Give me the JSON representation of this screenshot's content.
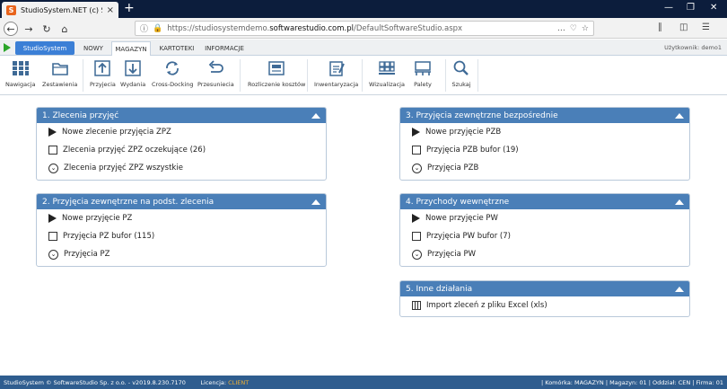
{
  "browser": {
    "tab_title": "StudioSystem.NET (c) Software",
    "favicon": "S",
    "url_prefix": "https://studiosystemdemo.",
    "url_domain": "softwarestudio.com.pl",
    "url_path": "/DefaultSoftwareStudio.aspx"
  },
  "appmenu": {
    "brand": "StudioSystem",
    "tabs": [
      "NOWY",
      "MAGAZYN",
      "KARTOTEKI",
      "INFORMACJE"
    ],
    "active_tab": "MAGAZYN",
    "user_label": "Użytkownik: demo1"
  },
  "ribbon": [
    {
      "label": "Nawigacja",
      "icon": "grid-icon"
    },
    {
      "label": "Zestawienia",
      "icon": "folder-icon"
    },
    {
      "label": "Przyjecia",
      "icon": "upload-icon"
    },
    {
      "label": "Wydania",
      "icon": "download-icon"
    },
    {
      "label": "Cross-Docking",
      "icon": "refresh-icon"
    },
    {
      "label": "Przesuniecia",
      "icon": "undo-icon"
    },
    {
      "label": "Rozliczenie kosztów",
      "icon": "register-icon"
    },
    {
      "label": "Inwentaryzacja",
      "icon": "clipboard-icon"
    },
    {
      "label": "Wizualizacja",
      "icon": "warehouse-icon"
    },
    {
      "label": "Palety",
      "icon": "pallet-icon"
    },
    {
      "label": "Szukaj",
      "icon": "search-icon"
    }
  ],
  "panels": [
    {
      "title": "1. Zlecenia przyjęć",
      "items": [
        {
          "icon": "play",
          "label": "Nowe zlecenie przyjęcia ZPZ"
        },
        {
          "icon": "square",
          "label": "Zlecenia przyjęć ZPZ oczekujące (26)"
        },
        {
          "icon": "circle",
          "label": "Zlecenia przyjęć ZPZ wszystkie"
        }
      ]
    },
    {
      "title": "2. Przyjęcia zewnętrzne na podst. zlecenia",
      "items": [
        {
          "icon": "play",
          "label": "Nowe przyjęcie PZ"
        },
        {
          "icon": "square",
          "label": "Przyjęcia PZ bufor (115)"
        },
        {
          "icon": "circle",
          "label": "Przyjęcia PZ"
        }
      ]
    },
    {
      "title": "3. Przyjęcia zewnętrzne bezpośrednie",
      "items": [
        {
          "icon": "play",
          "label": "Nowe przyjęcie PZB"
        },
        {
          "icon": "square",
          "label": "Przyjęcia PZB bufor (19)"
        },
        {
          "icon": "circle",
          "label": "Przyjęcia PZB"
        }
      ]
    },
    {
      "title": "4. Przychody wewnętrzne",
      "items": [
        {
          "icon": "play",
          "label": "Nowe przyjęcie PW"
        },
        {
          "icon": "square",
          "label": "Przyjęcia PW bufor (7)"
        },
        {
          "icon": "circle",
          "label": "Przyjęcia PW"
        }
      ]
    },
    {
      "title": "5. Inne działania",
      "items": [
        {
          "icon": "xls",
          "label": "Import zleceń z pliku Excel (xls)"
        }
      ]
    }
  ],
  "statusbar": {
    "left": "StudioSystem © SoftwareStudio Sp. z o.o. - v2019.8.230.7170",
    "license_label": "Licencja:",
    "license_value": "CLIENT",
    "right": "| Komórka: MAGAZYN | Magazyn: 01 | Oddział: CEN | Firma: 01"
  },
  "colors": {
    "panel_header": "#4a7fb8",
    "status_bar": "#2f5d8f",
    "brand_button": "#3b7fd6",
    "license": "#f2b233"
  }
}
